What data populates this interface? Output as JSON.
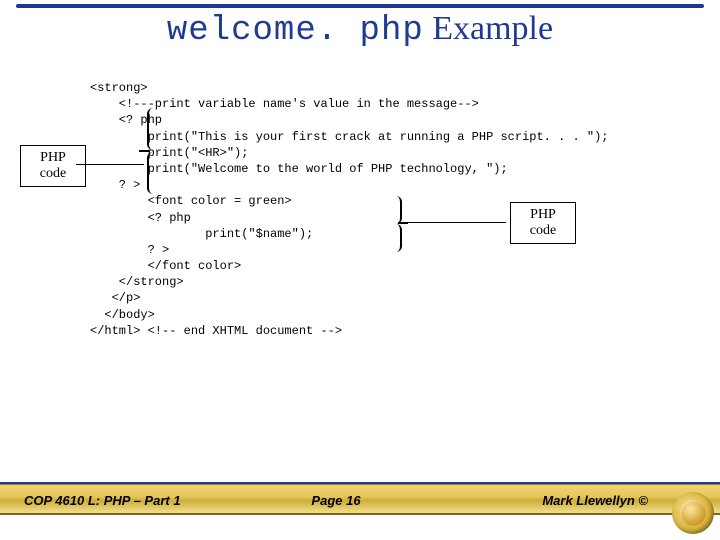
{
  "title": {
    "mono": "welcome. php",
    "suffix": " Example"
  },
  "code_lines": [
    "<strong>",
    "    <!---print variable name's value in the message-->",
    "    <? php",
    "        print(\"This is your first crack at running a PHP script. . . \");",
    "        print(\"<HR>\");",
    "        print(\"Welcome to the world of PHP technology, \");",
    "    ? >",
    "        <font color = green>",
    "        <? php",
    "                print(\"$name\");",
    "        ? >",
    "        </font color>",
    "    </strong>",
    "   </p>",
    "  </body>",
    "</html> <!-- end XHTML document -->"
  ],
  "callouts": {
    "left": "PHP code",
    "right": "PHP code"
  },
  "footer": {
    "course": "COP 4610 L: PHP – Part 1",
    "page": "Page 16",
    "author": "Mark Llewellyn ©"
  }
}
